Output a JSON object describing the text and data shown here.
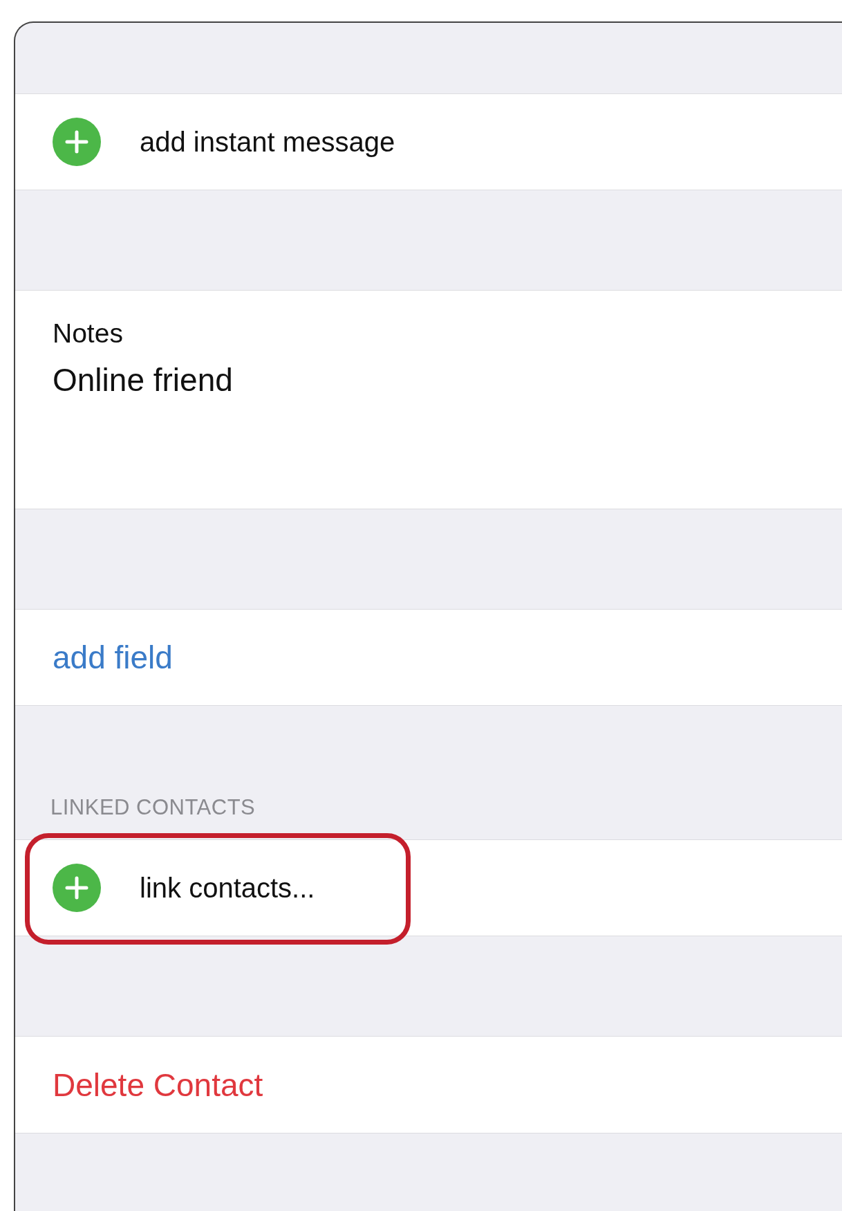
{
  "sections": [
    {
      "kind": "add",
      "label": "add instant message",
      "highlighted": false
    },
    {
      "kind": "notes",
      "label": "Notes",
      "value": "Online friend"
    },
    {
      "kind": "link-action",
      "label": "add field"
    },
    {
      "kind": "add",
      "header": "LINKED CONTACTS",
      "label": "link contacts...",
      "highlighted": true
    },
    {
      "kind": "destructive-action",
      "label": "Delete Contact"
    }
  ]
}
